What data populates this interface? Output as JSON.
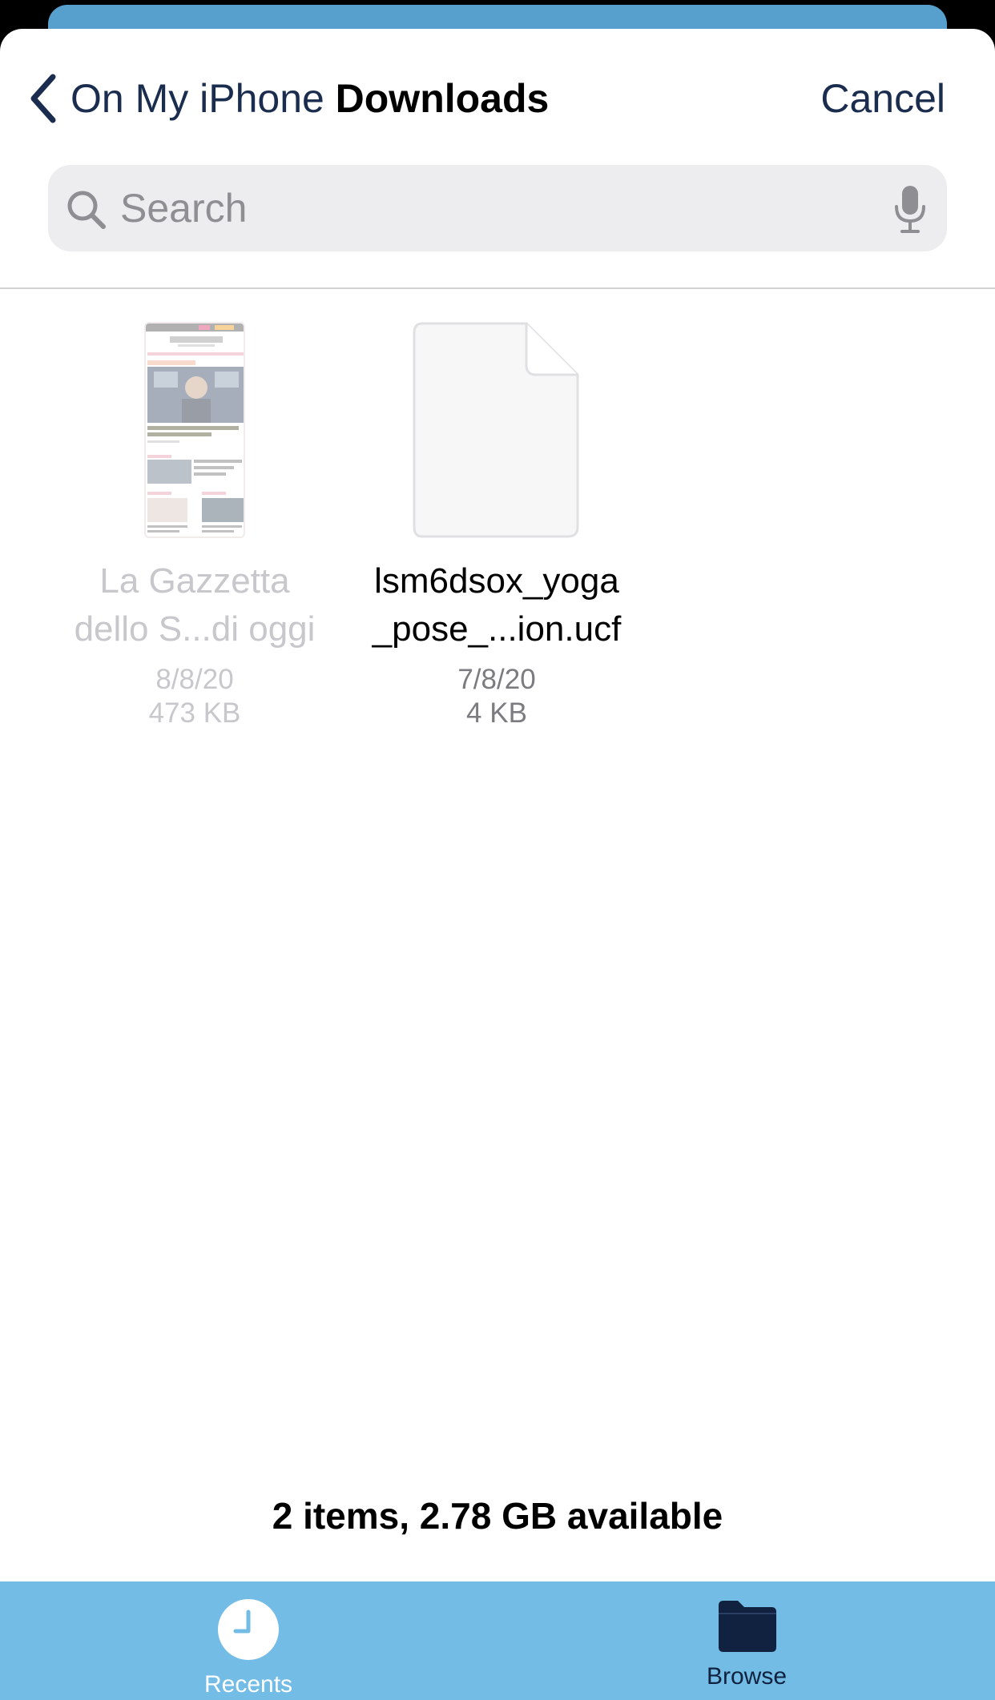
{
  "nav": {
    "back_label": "On My iPhone",
    "title": "Downloads",
    "cancel_label": "Cancel"
  },
  "search": {
    "placeholder": "Search"
  },
  "files": [
    {
      "name_line1": "La Gazzetta",
      "name_line2": "dello S...di oggi",
      "date": "8/8/20",
      "size": "473 KB",
      "dimmed": true
    },
    {
      "name_line1": "lsm6dsox_yoga",
      "name_line2": "_pose_...ion.ucf",
      "date": "7/8/20",
      "size": "4 KB",
      "dimmed": false
    }
  ],
  "status": "2 items, 2.78 GB available",
  "tabs": [
    {
      "label": "Recents",
      "icon": "clock-icon"
    },
    {
      "label": "Browse",
      "icon": "folder-icon"
    }
  ],
  "colors": {
    "accent": "#1b2d4f",
    "tabbar": "#73bce5",
    "underlay": "#57a0cd"
  }
}
